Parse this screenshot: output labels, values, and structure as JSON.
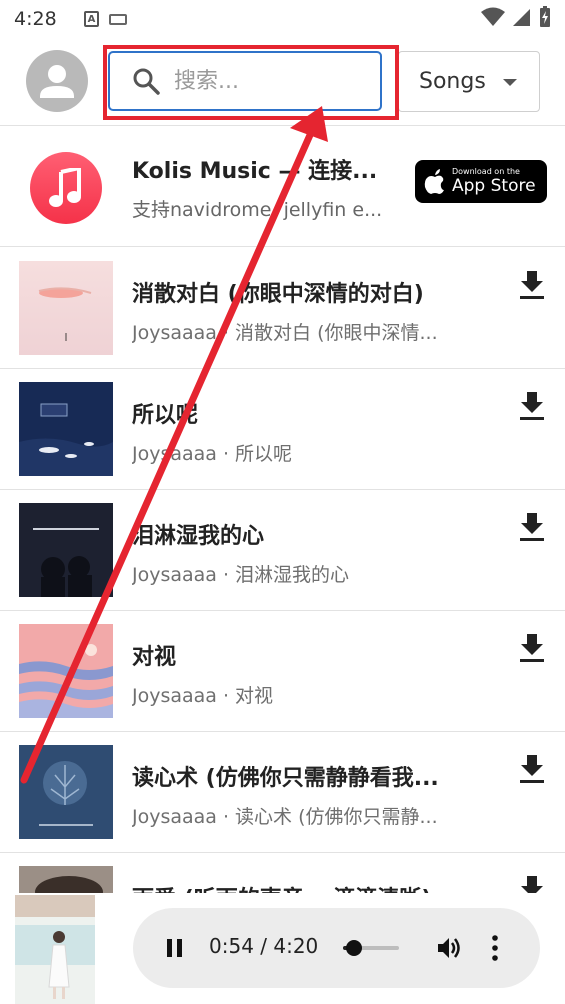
{
  "status_bar": {
    "time": "4:28"
  },
  "header": {
    "search_placeholder": "搜索...",
    "dropdown_value": "Songs"
  },
  "promo": {
    "title": "Kolis Music — 连接...",
    "subtitle": "支持navidrome, jellyfin e...",
    "badge_small": "Download on the",
    "badge_large": "App Store"
  },
  "songs": [
    {
      "title": "消散对白 (你眼中深情的对白)",
      "meta": "Joysaaaa · 消散对白 (你眼中深情..."
    },
    {
      "title": "所以呢",
      "meta": "Joysaaaa · 所以呢"
    },
    {
      "title": "泪淋湿我的心",
      "meta": "Joysaaaa · 泪淋湿我的心"
    },
    {
      "title": "对视",
      "meta": "Joysaaaa · 对视"
    },
    {
      "title": "读心术 (仿佛你只需静静看我...",
      "meta": "Joysaaaa · 读心术 (仿佛你只需静..."
    },
    {
      "title": "雨爱 (听雨的声音 一滴滴清晰)",
      "meta": ""
    }
  ],
  "player": {
    "time_text": "0:54 / 4:20",
    "progress": 0.2
  },
  "colors": {
    "annotation_red": "#e52530",
    "search_border": "#2f73c9",
    "promo_icon": "#f53249"
  }
}
